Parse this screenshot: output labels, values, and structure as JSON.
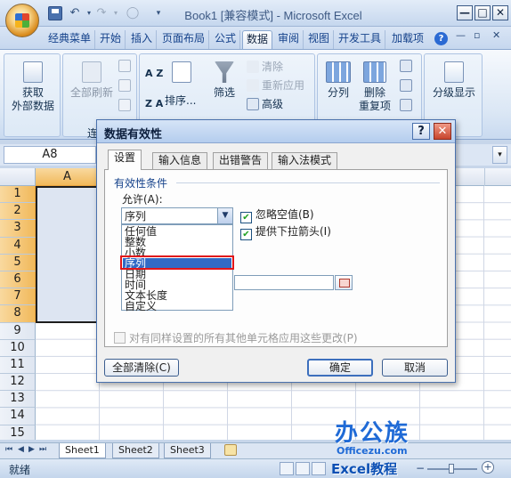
{
  "window": {
    "title": "Book1 [兼容模式] - Microsoft Excel",
    "min": "—",
    "max": "□",
    "close": "✕"
  },
  "qat": {
    "undo": "↶",
    "redo": "↷",
    "dd": "▾",
    "more": "▾"
  },
  "tabs": [
    {
      "label": "经典菜单"
    },
    {
      "label": "开始"
    },
    {
      "label": "插入"
    },
    {
      "label": "页面布局"
    },
    {
      "label": "公式"
    },
    {
      "label": "数据"
    },
    {
      "label": "审阅"
    },
    {
      "label": "视图"
    },
    {
      "label": "开发工具"
    },
    {
      "label": "加载项"
    }
  ],
  "active_tab": "数据",
  "ribbon": {
    "get_external": "获取\n外部数据",
    "refresh_all": "全部刷新",
    "sort": "排序...",
    "filter": "筛选",
    "clear": "清除",
    "reapply": "重新应用",
    "advanced": "高级",
    "text_to_columns": "分列",
    "remove_duplicates": "删除\n重复项",
    "outline": "分级显示",
    "sort_az": "A Z",
    "sort_za": "Z A",
    "group_fragment": "连"
  },
  "namebox": "A8",
  "columns": [
    "A"
  ],
  "rows": [
    "1",
    "2",
    "3",
    "4",
    "5",
    "6",
    "7",
    "8",
    "9",
    "10",
    "11",
    "12",
    "13",
    "14",
    "15"
  ],
  "sheets": [
    "Sheet1",
    "Sheet2",
    "Sheet3"
  ],
  "status": "就绪",
  "watermark": {
    "logo": "办公族",
    "site": "Officezu.com",
    "edu": "Excel教程"
  },
  "dialog": {
    "title": "数据有效性",
    "help": "?",
    "close": "✕",
    "tabs": [
      "设置",
      "输入信息",
      "出错警告",
      "输入法模式"
    ],
    "section": "有效性条件",
    "allow_label": "允许(A):",
    "allow_value": "序列",
    "allow_options": [
      "任何值",
      "整数",
      "小数",
      "序列",
      "日期",
      "时间",
      "文本长度",
      "自定义"
    ],
    "selected_option": "序列",
    "ignore_blank": "忽略空值(B)",
    "dropdown_arrow": "提供下拉箭头(I)",
    "apply_all": "对有同样设置的所有其他单元格应用这些更改(P)",
    "clear_all": "全部清除(C)",
    "ok": "确定",
    "cancel": "取消"
  }
}
